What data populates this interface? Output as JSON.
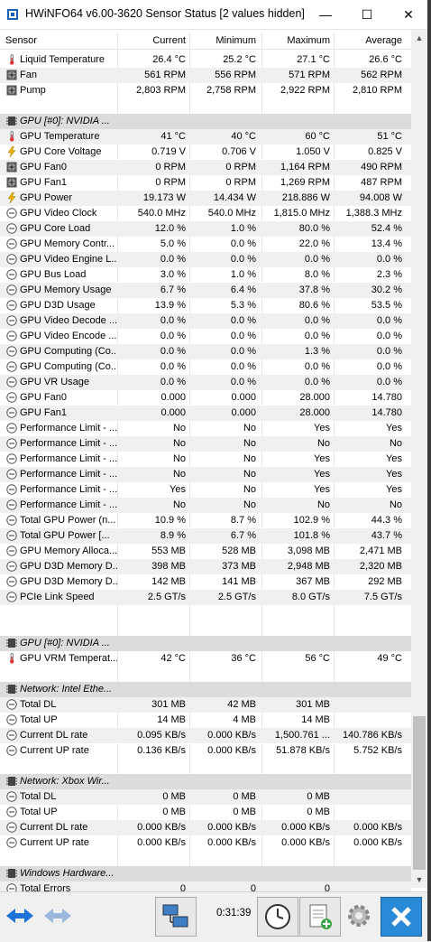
{
  "window": {
    "title": "HWiNFO64 v6.00-3620 Sensor Status [2 values hidden]",
    "minimize_glyph": "—",
    "maximize_glyph": "☐",
    "close_glyph": "✕"
  },
  "headers": {
    "sensor": "Sensor",
    "current": "Current",
    "minimum": "Minimum",
    "maximum": "Maximum",
    "average": "Average"
  },
  "rows": [
    {
      "type": "data",
      "icon": "thermometer-icon",
      "name": "Liquid Temperature",
      "cur": "26.4 °C",
      "min": "25.2 °C",
      "max": "27.1 °C",
      "avg": "26.6 °C"
    },
    {
      "type": "data",
      "icon": "fan-icon",
      "name": "Fan",
      "cur": "561 RPM",
      "min": "556 RPM",
      "max": "571 RPM",
      "avg": "562 RPM"
    },
    {
      "type": "data",
      "icon": "fan-icon",
      "name": "Pump",
      "cur": "2,803 RPM",
      "min": "2,758 RPM",
      "max": "2,922 RPM",
      "avg": "2,810 RPM"
    },
    {
      "type": "blank"
    },
    {
      "type": "group",
      "icon": "chip-icon",
      "name": "GPU [#0]: NVIDIA ..."
    },
    {
      "type": "data",
      "icon": "thermometer-icon",
      "name": "GPU Temperature",
      "cur": "41 °C",
      "min": "40 °C",
      "max": "60 °C",
      "avg": "51 °C"
    },
    {
      "type": "data",
      "icon": "bolt-icon",
      "name": "GPU Core Voltage",
      "cur": "0.719 V",
      "min": "0.706 V",
      "max": "1.050 V",
      "avg": "0.825 V"
    },
    {
      "type": "data",
      "icon": "fan-icon",
      "name": "GPU Fan0",
      "cur": "0 RPM",
      "min": "0 RPM",
      "max": "1,164 RPM",
      "avg": "490 RPM"
    },
    {
      "type": "data",
      "icon": "fan-icon",
      "name": "GPU Fan1",
      "cur": "0 RPM",
      "min": "0 RPM",
      "max": "1,269 RPM",
      "avg": "487 RPM"
    },
    {
      "type": "data",
      "icon": "bolt-icon",
      "name": "GPU Power",
      "cur": "19.173 W",
      "min": "14.434 W",
      "max": "218.886 W",
      "avg": "94.008 W"
    },
    {
      "type": "data",
      "icon": "gauge-icon",
      "name": "GPU Video Clock",
      "cur": "540.0 MHz",
      "min": "540.0 MHz",
      "max": "1,815.0 MHz",
      "avg": "1,388.3 MHz"
    },
    {
      "type": "data",
      "icon": "gauge-icon",
      "name": "GPU Core Load",
      "cur": "12.0 %",
      "min": "1.0 %",
      "max": "80.0 %",
      "avg": "52.4 %"
    },
    {
      "type": "data",
      "icon": "gauge-icon",
      "name": "GPU Memory Contr...",
      "cur": "5.0 %",
      "min": "0.0 %",
      "max": "22.0 %",
      "avg": "13.4 %"
    },
    {
      "type": "data",
      "icon": "gauge-icon",
      "name": "GPU Video Engine L...",
      "cur": "0.0 %",
      "min": "0.0 %",
      "max": "0.0 %",
      "avg": "0.0 %"
    },
    {
      "type": "data",
      "icon": "gauge-icon",
      "name": "GPU Bus Load",
      "cur": "3.0 %",
      "min": "1.0 %",
      "max": "8.0 %",
      "avg": "2.3 %"
    },
    {
      "type": "data",
      "icon": "gauge-icon",
      "name": "GPU Memory Usage",
      "cur": "6.7 %",
      "min": "6.4 %",
      "max": "37.8 %",
      "avg": "30.2 %"
    },
    {
      "type": "data",
      "icon": "gauge-icon",
      "name": "GPU D3D Usage",
      "cur": "13.9 %",
      "min": "5.3 %",
      "max": "80.6 %",
      "avg": "53.5 %"
    },
    {
      "type": "data",
      "icon": "gauge-icon",
      "name": "GPU Video Decode ...",
      "cur": "0.0 %",
      "min": "0.0 %",
      "max": "0.0 %",
      "avg": "0.0 %"
    },
    {
      "type": "data",
      "icon": "gauge-icon",
      "name": "GPU Video Encode ...",
      "cur": "0.0 %",
      "min": "0.0 %",
      "max": "0.0 %",
      "avg": "0.0 %"
    },
    {
      "type": "data",
      "icon": "gauge-icon",
      "name": "GPU Computing (Co...",
      "cur": "0.0 %",
      "min": "0.0 %",
      "max": "1.3 %",
      "avg": "0.0 %"
    },
    {
      "type": "data",
      "icon": "gauge-icon",
      "name": "GPU Computing (Co...",
      "cur": "0.0 %",
      "min": "0.0 %",
      "max": "0.0 %",
      "avg": "0.0 %"
    },
    {
      "type": "data",
      "icon": "gauge-icon",
      "name": "GPU VR Usage",
      "cur": "0.0 %",
      "min": "0.0 %",
      "max": "0.0 %",
      "avg": "0.0 %"
    },
    {
      "type": "data",
      "icon": "gauge-icon",
      "name": "GPU Fan0",
      "cur": "0.000",
      "min": "0.000",
      "max": "28.000",
      "avg": "14.780"
    },
    {
      "type": "data",
      "icon": "gauge-icon",
      "name": "GPU Fan1",
      "cur": "0.000",
      "min": "0.000",
      "max": "28.000",
      "avg": "14.780"
    },
    {
      "type": "data",
      "icon": "gauge-icon",
      "name": "Performance Limit - ...",
      "cur": "No",
      "min": "No",
      "max": "Yes",
      "avg": "Yes"
    },
    {
      "type": "data",
      "icon": "gauge-icon",
      "name": "Performance Limit - ...",
      "cur": "No",
      "min": "No",
      "max": "No",
      "avg": "No"
    },
    {
      "type": "data",
      "icon": "gauge-icon",
      "name": "Performance Limit - ...",
      "cur": "No",
      "min": "No",
      "max": "Yes",
      "avg": "Yes"
    },
    {
      "type": "data",
      "icon": "gauge-icon",
      "name": "Performance Limit - ...",
      "cur": "No",
      "min": "No",
      "max": "Yes",
      "avg": "Yes"
    },
    {
      "type": "data",
      "icon": "gauge-icon",
      "name": "Performance Limit - ...",
      "cur": "Yes",
      "min": "No",
      "max": "Yes",
      "avg": "Yes"
    },
    {
      "type": "data",
      "icon": "gauge-icon",
      "name": "Performance Limit - ...",
      "cur": "No",
      "min": "No",
      "max": "No",
      "avg": "No"
    },
    {
      "type": "data",
      "icon": "gauge-icon",
      "name": "Total GPU Power (n...",
      "cur": "10.9 %",
      "min": "8.7 %",
      "max": "102.9 %",
      "avg": "44.3 %"
    },
    {
      "type": "data",
      "icon": "gauge-icon",
      "name": "Total GPU Power [...",
      "cur": "8.9 %",
      "min": "6.7 %",
      "max": "101.8 %",
      "avg": "43.7 %"
    },
    {
      "type": "data",
      "icon": "gauge-icon",
      "name": "GPU Memory Alloca...",
      "cur": "553 MB",
      "min": "528 MB",
      "max": "3,098 MB",
      "avg": "2,471 MB"
    },
    {
      "type": "data",
      "icon": "gauge-icon",
      "name": "GPU D3D Memory D...",
      "cur": "398 MB",
      "min": "373 MB",
      "max": "2,948 MB",
      "avg": "2,320 MB"
    },
    {
      "type": "data",
      "icon": "gauge-icon",
      "name": "GPU D3D Memory D...",
      "cur": "142 MB",
      "min": "141 MB",
      "max": "367 MB",
      "avg": "292 MB"
    },
    {
      "type": "data",
      "icon": "gauge-icon",
      "name": "PCIe Link Speed",
      "cur": "2.5 GT/s",
      "min": "2.5 GT/s",
      "max": "8.0 GT/s",
      "avg": "7.5 GT/s"
    },
    {
      "type": "blank"
    },
    {
      "type": "blank"
    },
    {
      "type": "group",
      "icon": "chip-icon",
      "name": "GPU [#0]: NVIDIA ..."
    },
    {
      "type": "data",
      "icon": "thermometer-icon",
      "name": "GPU VRM Temperat...",
      "cur": "42 °C",
      "min": "36 °C",
      "max": "56 °C",
      "avg": "49 °C"
    },
    {
      "type": "blank"
    },
    {
      "type": "group",
      "icon": "chip-icon",
      "name": "Network: Intel Ethe..."
    },
    {
      "type": "data",
      "icon": "gauge-icon",
      "name": "Total DL",
      "cur": "301 MB",
      "min": "42 MB",
      "max": "301 MB",
      "avg": ""
    },
    {
      "type": "data",
      "icon": "gauge-icon",
      "name": "Total UP",
      "cur": "14 MB",
      "min": "4 MB",
      "max": "14 MB",
      "avg": ""
    },
    {
      "type": "data",
      "icon": "gauge-icon",
      "name": "Current DL rate",
      "cur": "0.095 KB/s",
      "min": "0.000 KB/s",
      "max": "1,500.761 ...",
      "avg": "140.786 KB/s"
    },
    {
      "type": "data",
      "icon": "gauge-icon",
      "name": "Current UP rate",
      "cur": "0.136 KB/s",
      "min": "0.000 KB/s",
      "max": "51.878 KB/s",
      "avg": "5.752 KB/s"
    },
    {
      "type": "blank"
    },
    {
      "type": "group",
      "icon": "chip-icon",
      "name": "Network: Xbox Wir..."
    },
    {
      "type": "data",
      "icon": "gauge-icon",
      "name": "Total DL",
      "cur": "0 MB",
      "min": "0 MB",
      "max": "0 MB",
      "avg": ""
    },
    {
      "type": "data",
      "icon": "gauge-icon",
      "name": "Total UP",
      "cur": "0 MB",
      "min": "0 MB",
      "max": "0 MB",
      "avg": ""
    },
    {
      "type": "data",
      "icon": "gauge-icon",
      "name": "Current DL rate",
      "cur": "0.000 KB/s",
      "min": "0.000 KB/s",
      "max": "0.000 KB/s",
      "avg": "0.000 KB/s"
    },
    {
      "type": "data",
      "icon": "gauge-icon",
      "name": "Current UP rate",
      "cur": "0.000 KB/s",
      "min": "0.000 KB/s",
      "max": "0.000 KB/s",
      "avg": "0.000 KB/s"
    },
    {
      "type": "blank"
    },
    {
      "type": "group",
      "icon": "chip-icon",
      "name": "Windows Hardware..."
    },
    {
      "type": "data",
      "icon": "gauge-icon",
      "name": "Total Errors",
      "cur": "0",
      "min": "0",
      "max": "0",
      "avg": ""
    }
  ],
  "toolbar": {
    "elapsed_time": "0:31:39"
  },
  "colors": {
    "accent_blue": "#1e73d8",
    "group_bg": "#dcdcdc",
    "alt_row": "#f0f0f0",
    "close_button_bg": "#2a8ad8"
  }
}
